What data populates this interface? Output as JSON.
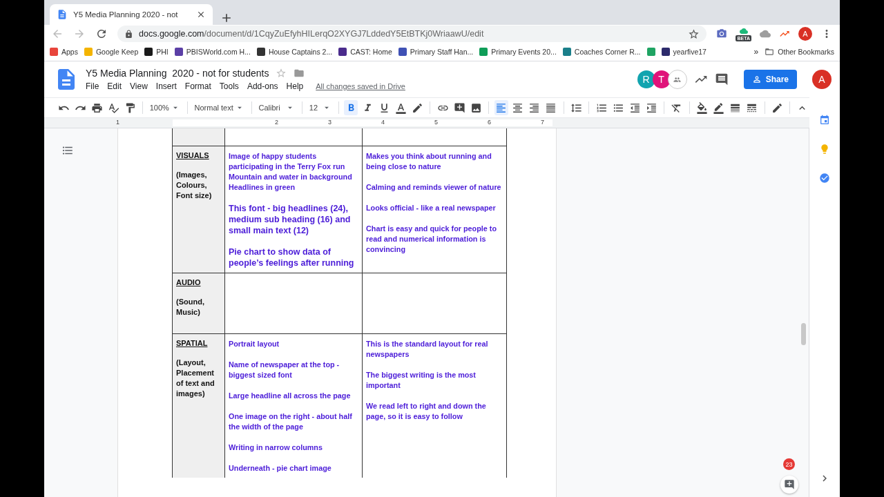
{
  "browser": {
    "tab": {
      "title": "Y5 Media Planning 2020 - not"
    },
    "address": {
      "host": "docs.google.com",
      "path": "/document/d/1CqyZuEfyhHILerqO2XYGJ7LddedY5EtBTKj0WriaawU/edit"
    },
    "extension_badge": "BETA",
    "profile": "A",
    "bookmarks": [
      {
        "label": "Apps",
        "color": "#e8453c"
      },
      {
        "label": "Google Keep",
        "color": "#f4b400"
      },
      {
        "label": "PHI",
        "color": "#1a1a1a"
      },
      {
        "label": "PBISWorld.com H...",
        "color": "#5b3fa6"
      },
      {
        "label": "House Captains 2...",
        "color": "#333333"
      },
      {
        "label": "CAST: Home",
        "color": "#4a2b8c"
      },
      {
        "label": "Primary Staff Han...",
        "color": "#3f51b5"
      },
      {
        "label": "Primary Events 20...",
        "color": "#0f9d58"
      },
      {
        "label": "Coaches Corner R...",
        "color": "#1a7f8a"
      },
      {
        "color": "#1fa463"
      },
      {
        "label": "yearfive17",
        "color": "#2c2a6b"
      }
    ],
    "bookmarks_more": "»",
    "other_bookmarks": "Other Bookmarks"
  },
  "docs": {
    "title": "Y5 Media Planning  2020 - not for students",
    "menus": [
      "File",
      "Edit",
      "View",
      "Insert",
      "Format",
      "Tools",
      "Add-ons",
      "Help"
    ],
    "save_status": "All changes saved in Drive",
    "collaborators": [
      {
        "initial": "R",
        "color": "#12a4af"
      },
      {
        "initial": "T",
        "color": "#e0147a"
      }
    ],
    "share": "Share",
    "account": "A"
  },
  "toolbar": {
    "zoom": "100%",
    "style": "Normal text",
    "font": "Calibri",
    "size": "12",
    "format_buttons": [
      {
        "kind": "bold",
        "selected": true
      },
      {
        "kind": "italic",
        "selected": false
      },
      {
        "kind": "underline",
        "selected": false
      }
    ],
    "align_buttons": [
      {
        "kind": "left",
        "selected": true
      },
      {
        "kind": "center",
        "selected": false
      },
      {
        "kind": "right",
        "selected": false
      },
      {
        "kind": "justify",
        "selected": false
      }
    ]
  },
  "ruler": [
    "1",
    "2",
    "3",
    "4",
    "5",
    "6",
    "7"
  ],
  "table": {
    "rows": [
      {
        "heading": "VISUALS",
        "subheading": "(Images, Colours, Font size)",
        "column_2": [
          {
            "kind": "normal",
            "text": "Image of happy students participating in the Terry Fox run Mountain and water in background Headlines in green"
          },
          {
            "kind": "large",
            "text": "This font - big headlines (24), medium sub heading (16) and small main text (12)"
          },
          {
            "kind": "large",
            "text": "Pie chart to show data of people’s feelings after running"
          }
        ],
        "column_3": [
          {
            "kind": "normal",
            "text": "Makes you think about running and being close to nature"
          },
          {
            "kind": "normal",
            "text": "Calming and reminds viewer of nature"
          },
          {
            "kind": "normal",
            "text": "Looks official - like a real newspaper"
          },
          {
            "kind": "normal",
            "text": "Chart is easy and quick for people to read and numerical information is convincing"
          }
        ]
      },
      {
        "heading": "AUDIO",
        "subheading": "(Sound, Music)",
        "column_2": [],
        "column_3": []
      },
      {
        "heading": "SPATIAL",
        "subheading": "(Layout, Placement of text and images)",
        "column_2": [
          {
            "kind": "normal",
            "text": "Portrait layout"
          },
          {
            "kind": "normal",
            "text": "Name of newspaper at the top - biggest sized font"
          },
          {
            "kind": "normal",
            "text": "Large headline all across the page"
          },
          {
            "kind": "normal",
            "text": "One image on the right - about half the width of the page"
          },
          {
            "kind": "normal",
            "text": "Writing in narrow columns"
          },
          {
            "kind": "normal",
            "text": "Underneath - pie chart image"
          }
        ],
        "column_3": [
          {
            "kind": "normal",
            "text": "This is the standard layout for real newspapers"
          },
          {
            "kind": "normal",
            "text": "The biggest writing is the most important"
          },
          {
            "kind": "normal",
            "text": "We read left to right and down the page, so it is easy to follow"
          }
        ]
      }
    ]
  },
  "notification_count": "23"
}
